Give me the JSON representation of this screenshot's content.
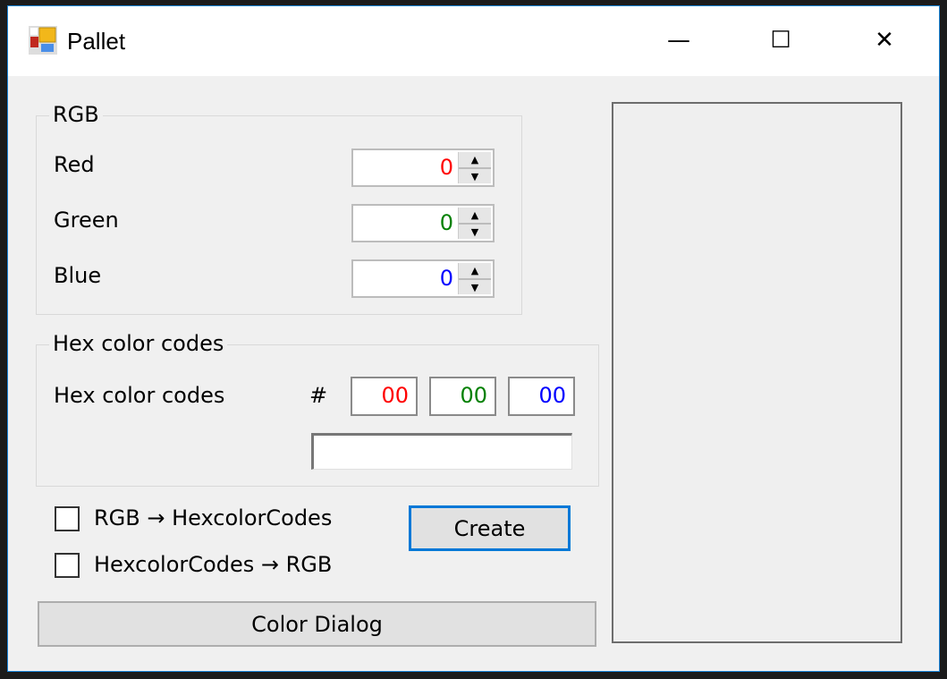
{
  "window": {
    "title": "Pallet",
    "minimize": "—",
    "maximize": "☐",
    "close": "✕"
  },
  "rgb": {
    "group_label": "RGB",
    "red_label": "Red",
    "green_label": "Green",
    "blue_label": "Blue",
    "red": "0",
    "green": "0",
    "blue": "0"
  },
  "hex": {
    "group_label": "Hex color codes",
    "row_label": "Hex color codes",
    "hash": "#",
    "r": "00",
    "g": "00",
    "b": "00",
    "full": ""
  },
  "options": {
    "rgb_to_hex": "RGB → HexcolorCodes",
    "hex_to_rgb": "HexcolorCodes → RGB",
    "rgb_to_hex_checked": false,
    "hex_to_rgb_checked": false
  },
  "buttons": {
    "create": "Create",
    "color_dialog": "Color Dialog"
  },
  "colors": {
    "red": "#ff0000",
    "green": "#008000",
    "blue": "#0000ff",
    "accent": "#0078d7"
  }
}
